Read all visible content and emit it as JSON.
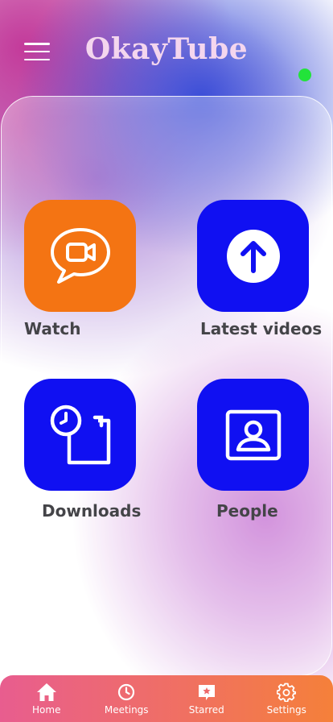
{
  "app": {
    "title": "OkayTube"
  },
  "colors": {
    "accent_orange": "#f47413",
    "accent_blue": "#1010f2",
    "online": "#22e33a",
    "nav_gradient_start": "#e85d8f",
    "nav_gradient_end": "#f5803a"
  },
  "tiles": [
    {
      "label": "Watch",
      "icon": "video-chat-icon",
      "color": "#f47413"
    },
    {
      "label": "Latest videos",
      "icon": "arrow-up-circle-icon",
      "color": "#1010f2"
    },
    {
      "label": "Downloads",
      "icon": "clock-calendar-icon",
      "color": "#1010f2"
    },
    {
      "label": "People",
      "icon": "contact-card-icon",
      "color": "#1010f2"
    }
  ],
  "nav": [
    {
      "label": "Home",
      "icon": "home-icon"
    },
    {
      "label": "Meetings",
      "icon": "clock-icon"
    },
    {
      "label": "Starred",
      "icon": "star-message-icon"
    },
    {
      "label": "Settings",
      "icon": "gear-icon"
    }
  ]
}
